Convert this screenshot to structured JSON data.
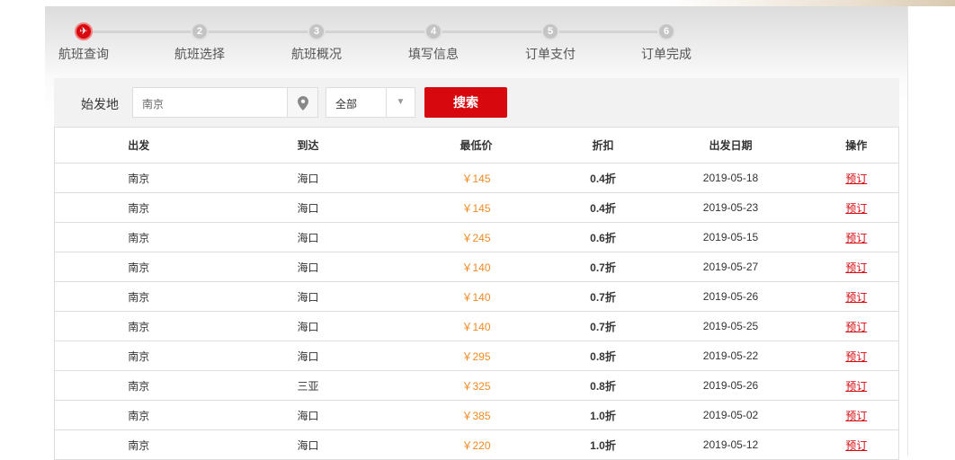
{
  "steps": [
    {
      "num": "✈",
      "label": "航班查询",
      "active": true
    },
    {
      "num": "2",
      "label": "航班选择"
    },
    {
      "num": "3",
      "label": "航班概况"
    },
    {
      "num": "4",
      "label": "填写信息"
    },
    {
      "num": "5",
      "label": "订单支付"
    },
    {
      "num": "6",
      "label": "订单完成"
    }
  ],
  "search": {
    "label": "始发地",
    "origin_value": "南京",
    "type_value": "全部",
    "button": "搜索"
  },
  "table": {
    "headers": [
      "出发",
      "到达",
      "最低价",
      "折扣",
      "出发日期",
      "操作"
    ],
    "rows": [
      {
        "from": "南京",
        "to": "海口",
        "price": "￥145",
        "discount": "0.4折",
        "date": "2019-05-18",
        "action": "预订"
      },
      {
        "from": "南京",
        "to": "海口",
        "price": "￥145",
        "discount": "0.4折",
        "date": "2019-05-23",
        "action": "预订"
      },
      {
        "from": "南京",
        "to": "海口",
        "price": "￥245",
        "discount": "0.6折",
        "date": "2019-05-15",
        "action": "预订"
      },
      {
        "from": "南京",
        "to": "海口",
        "price": "￥140",
        "discount": "0.7折",
        "date": "2019-05-27",
        "action": "预订"
      },
      {
        "from": "南京",
        "to": "海口",
        "price": "￥140",
        "discount": "0.7折",
        "date": "2019-05-26",
        "action": "预订"
      },
      {
        "from": "南京",
        "to": "海口",
        "price": "￥140",
        "discount": "0.7折",
        "date": "2019-05-25",
        "action": "预订"
      },
      {
        "from": "南京",
        "to": "海口",
        "price": "￥295",
        "discount": "0.8折",
        "date": "2019-05-22",
        "action": "预订"
      },
      {
        "from": "南京",
        "to": "三亚",
        "price": "￥325",
        "discount": "0.8折",
        "date": "2019-05-26",
        "action": "预订"
      },
      {
        "from": "南京",
        "to": "海口",
        "price": "￥385",
        "discount": "1.0折",
        "date": "2019-05-02",
        "action": "预订"
      },
      {
        "from": "南京",
        "to": "海口",
        "price": "￥220",
        "discount": "1.0折",
        "date": "2019-05-12",
        "action": "预订"
      }
    ]
  }
}
